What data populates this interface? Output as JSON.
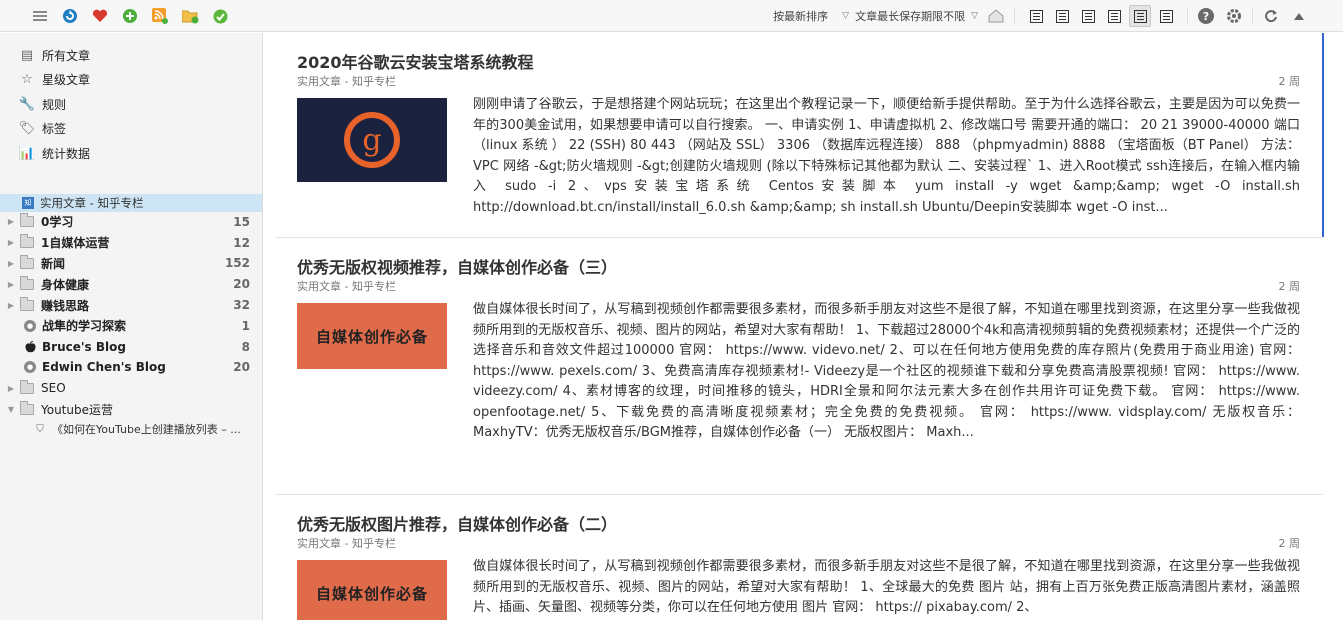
{
  "toolbar": {
    "sort_label": "按最新排序",
    "retention_label": "文章最长保存期限不限"
  },
  "sidebar": {
    "nav": [
      {
        "label": "所有文章",
        "icon": "list-icon"
      },
      {
        "label": "星级文章",
        "icon": "star-icon"
      },
      {
        "label": "规则",
        "icon": "wrench-icon"
      },
      {
        "label": "标签",
        "icon": "tag-icon"
      },
      {
        "label": "统计数据",
        "icon": "stats-icon"
      }
    ],
    "selected_feed": "实用文章 - 知乎专栏",
    "tree": [
      {
        "type": "folder",
        "label": "0学习",
        "count": "15",
        "bold": true
      },
      {
        "type": "folder",
        "label": "1自媒体运营",
        "count": "12",
        "bold": true
      },
      {
        "type": "folder",
        "label": "新闻",
        "count": "152",
        "bold": true
      },
      {
        "type": "folder",
        "label": "身体健康",
        "count": "20",
        "bold": true
      },
      {
        "type": "folder",
        "label": "赚钱思路",
        "count": "32",
        "bold": true
      },
      {
        "type": "feed",
        "label": "战隼的学习探索",
        "count": "1",
        "bold": true,
        "icon": "feed-circle-icon"
      },
      {
        "type": "feed",
        "label": "Bruce's Blog",
        "count": "8",
        "bold": true,
        "icon": "apple-icon"
      },
      {
        "type": "feed",
        "label": "Edwin Chen's Blog",
        "count": "20",
        "bold": true,
        "icon": "feed-circle-icon"
      },
      {
        "type": "folder",
        "label": "SEO",
        "count": "",
        "bold": false
      },
      {
        "type": "folder-open",
        "label": "Youtube运营",
        "count": "",
        "bold": false
      }
    ],
    "sub_item": "《如何在YouTube上创建播放列表 – ..."
  },
  "articles": [
    {
      "title": "2020年谷歌云安装宝塔系统教程",
      "source": "实用文章 - 知乎专栏",
      "age": "2 周",
      "thumb": "g",
      "excerpt": "刚刚申请了谷歌云，于是想搭建个网站玩玩；在这里出个教程记录一下，顺便给新手提供帮助。至于为什么选择谷歌云，主要是因为可以免费一年的300美金试用，如果想要申请可以自行搜索。 一、申请实例 1、申请虚拟机 2、修改端口号 需要开通的端口： 20 21 39000-40000 端口（linux 系统 ） 22 (SSH) 80 443 （网站及 SSL） 3306 （数据库远程连接） 888 （phpmyadmin) 8888 （宝塔面板（BT Panel） 方法：VPC 网络 -&gt;防火墙规则 -&gt;创建防火墙规则 (除以下特殊标记其他都为默认 二、安装过程` 1、进入Root模式 ssh连接后，在输入框内输入 sudo -i 2、vps安装宝塔系统 Centos安装脚本 yum install -y wget &amp;&amp; wget -O install.sh http://download.bt.cn/install/install_6.0.sh &amp;&amp; sh install.sh Ubuntu/Deepin安装脚本 wget -O inst..."
    },
    {
      "title": "优秀无版权视频推荐，自媒体创作必备（三）",
      "source": "实用文章 - 知乎专栏",
      "age": "2 周",
      "thumb": "自媒体创作必备",
      "excerpt": "做自媒体很长时间了，从写稿到视频创作都需要很多素材，而很多新手朋友对这些不是很了解，不知道在哪里找到资源，在这里分享一些我做视频所用到的无版权音乐、视频、图片的网站，希望对大家有帮助！ 1、下载超过28000个4k和高清视频剪辑的免费视频素材；还提供一个广泛的选择音乐和音效文件超过100000 官网： https://www. videvo.net/ 2、可以在任何地方使用免费的库存照片(免费用于商业用途) 官网： https://www. pexels.com/ 3、免费高清库存视频素材!- Videezy是一个社区的视频谁下载和分享免费高清股票视频! 官网： https://www. videezy.com/ 4、素材博客的纹理，时间推移的镜头，HDRI全景和阿尔法元素大多在创作共用许可证免费下载。 官网： https://www. openfootage.net/ 5、下载免费的高清晰度视频素材；完全免费的免费视频。 官网： https://www. vidsplay.com/ 无版权音乐： MaxhyTV：优秀无版权音乐/BGM推荐，自媒体创作必备（一） 无版权图片： Maxh..."
    },
    {
      "title": "优秀无版权图片推荐，自媒体创作必备（二）",
      "source": "实用文章 - 知乎专栏",
      "age": "2 周",
      "thumb": "自媒体创作必备",
      "excerpt": "做自媒体很长时间了，从写稿到视频创作都需要很多素材，而很多新手朋友对这些不是很了解，不知道在哪里找到资源，在这里分享一些我做视频所用到的无版权音乐、视频、图片的网站，希望对大家有帮助！ 1、全球最大的免费 图片 站，拥有上百万张免费正版高清图片素材，涵盖照片、插画、矢量图、视频等分类，你可以在任何地方使用 图片 官网： https:// pixabay.com/ 2、"
    }
  ]
}
